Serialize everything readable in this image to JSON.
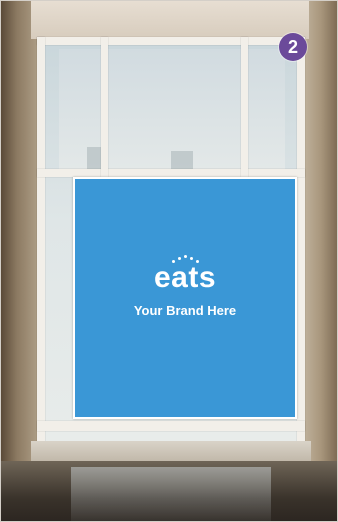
{
  "badge": {
    "number": "2",
    "color": "#6b4a9a"
  },
  "window_decal": {
    "logo": "eats",
    "tagline": "Your Brand Here",
    "panel_color": "#3a97d6"
  }
}
